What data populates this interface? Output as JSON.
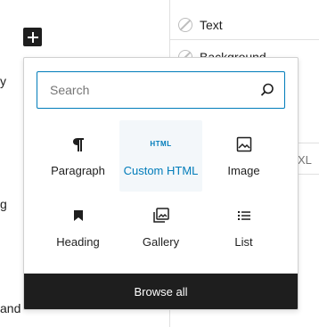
{
  "background": {
    "text_fragments": [
      "y",
      "g",
      "and"
    ],
    "style_options": [
      {
        "label": "Text"
      },
      {
        "label": "Background"
      }
    ],
    "size_label": "XL"
  },
  "inserter": {
    "search": {
      "placeholder": "Search",
      "value": ""
    },
    "blocks": [
      {
        "label": "Paragraph",
        "icon": "paragraph-icon"
      },
      {
        "label": "Custom HTML",
        "icon": "html-icon",
        "icon_text": "HTML",
        "active": true
      },
      {
        "label": "Image",
        "icon": "image-icon"
      },
      {
        "label": "Heading",
        "icon": "heading-icon"
      },
      {
        "label": "Gallery",
        "icon": "gallery-icon"
      },
      {
        "label": "List",
        "icon": "list-icon"
      }
    ],
    "browse_all_label": "Browse all"
  },
  "colors": {
    "accent": "#007cba",
    "dark": "#1e1e1e"
  }
}
